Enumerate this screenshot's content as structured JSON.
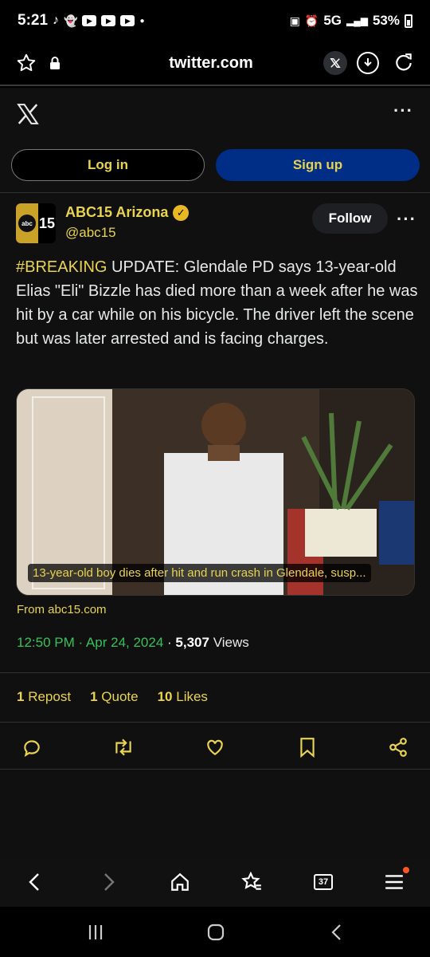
{
  "status_bar": {
    "time": "5:21",
    "network": "5G",
    "battery": "53%"
  },
  "browser": {
    "url": "twitter.com"
  },
  "auth": {
    "login_label": "Log in",
    "signup_label": "Sign up"
  },
  "tweet": {
    "author_name": "ABC15 Arizona",
    "author_handle": "@abc15",
    "avatar_text": "15",
    "avatar_badge": "abc",
    "follow_label": "Follow",
    "hashtag": "#BREAKING",
    "body": " UPDATE: Glendale PD says 13-year-old Elias \"Eli\" Bizzle has died more than a week after he was hit by a car while on his bicycle. The driver left the scene but was later arrested and is facing charges.",
    "card_caption": "13-year-old boy dies after hit and run crash in Glendale, susp...",
    "card_source": "From abc15.com",
    "time": "12:50 PM · Apr 24, 2024",
    "separator": " · ",
    "views_count": "5,307",
    "views_label": "Views",
    "reposts_count": "1",
    "reposts_label": "Repost",
    "quotes_count": "1",
    "quotes_label": "Quote",
    "likes_count": "10",
    "likes_label": "Likes"
  },
  "nav": {
    "tabs_count": "37"
  },
  "colors": {
    "accent_yellow": "#e8d44d",
    "signup_blue": "#002d85",
    "time_green": "#35c159"
  },
  "icons": [
    "tiktok-icon",
    "snapchat-icon",
    "youtube-icon",
    "star-icon",
    "lock-icon",
    "x-logo-icon",
    "download-icon",
    "reload-icon",
    "reply-icon",
    "retweet-icon",
    "like-icon",
    "bookmark-icon",
    "share-icon",
    "back-icon",
    "forward-icon",
    "home-icon",
    "bookmarks-icon",
    "tabs-icon",
    "menu-icon"
  ]
}
